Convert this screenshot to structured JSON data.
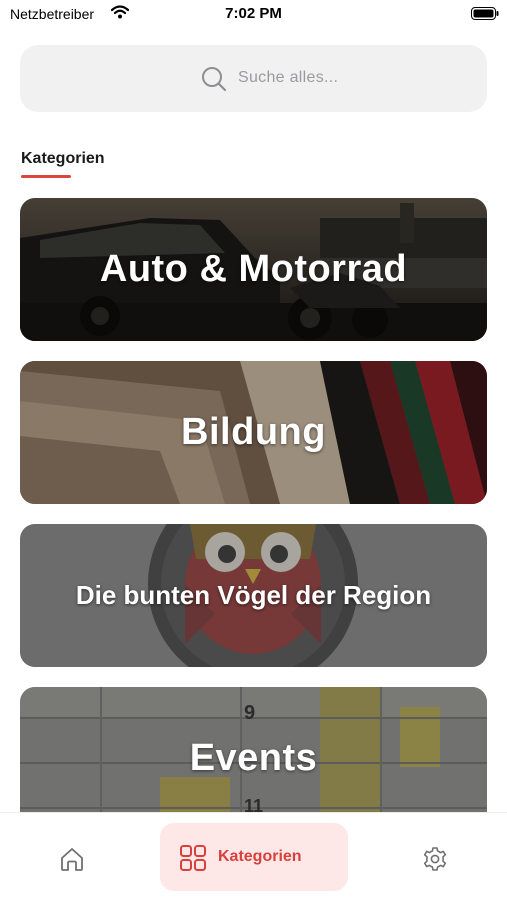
{
  "status_bar": {
    "carrier": "Netzbetreiber",
    "time": "7:02 PM"
  },
  "search": {
    "placeholder": "Suche alles..."
  },
  "section": {
    "title": "Kategorien"
  },
  "categories": [
    {
      "label": "Auto & Motorrad"
    },
    {
      "label": "Bildung"
    },
    {
      "label": "Die bunten Vögel der Region"
    },
    {
      "label": "Events"
    }
  ],
  "tab_bar": {
    "active_label": "Kategorien",
    "icons": [
      "home-icon",
      "grid-icon",
      "gear-icon"
    ]
  },
  "colors": {
    "accent": "#e0433e",
    "active_tab_bg": "#fde8e7",
    "search_bg": "#f1f1f2"
  }
}
